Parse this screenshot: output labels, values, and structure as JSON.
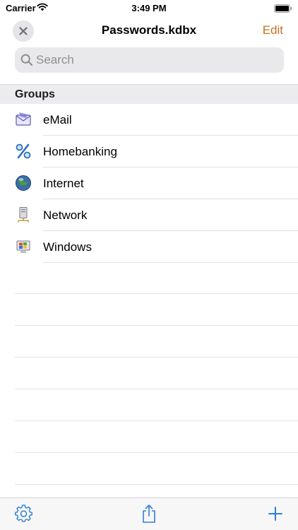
{
  "status_bar": {
    "carrier": "Carrier",
    "time": "3:49 PM"
  },
  "nav": {
    "title": "Passwords.kdbx",
    "edit_label": "Edit",
    "close_icon": "close-icon"
  },
  "search": {
    "placeholder": "Search",
    "value": ""
  },
  "section": {
    "title": "Groups"
  },
  "groups": [
    {
      "label": "eMail",
      "icon": "email-envelope-icon"
    },
    {
      "label": "Homebanking",
      "icon": "percent-icon"
    },
    {
      "label": "Internet",
      "icon": "globe-icon"
    },
    {
      "label": "Network",
      "icon": "network-server-icon"
    },
    {
      "label": "Windows",
      "icon": "windows-computer-icon"
    }
  ],
  "toolbar": {
    "settings_icon": "gear-icon",
    "share_icon": "share-icon",
    "add_icon": "plus-icon"
  },
  "colors": {
    "accent": "#c46f22",
    "toolbar_tint": "#2f7fd8",
    "section_bg": "#ececef"
  }
}
